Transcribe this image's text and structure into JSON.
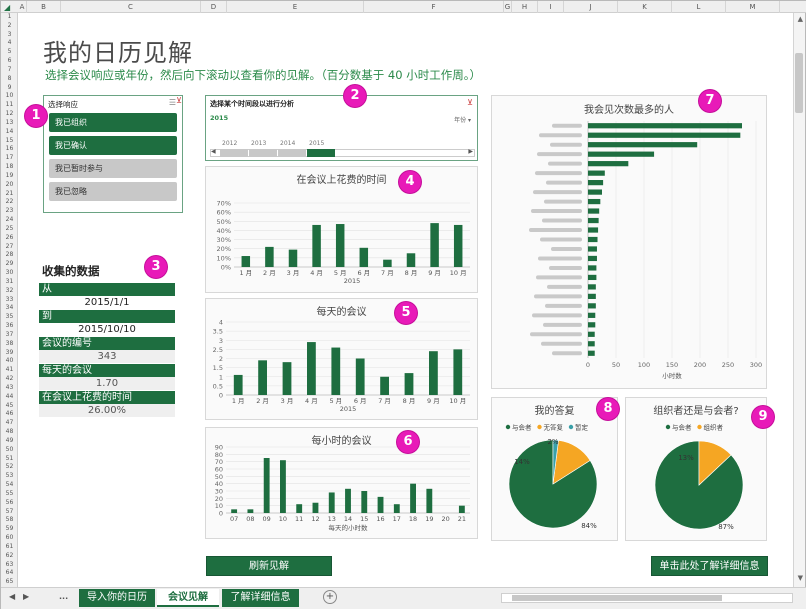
{
  "sheet": {
    "columns": [
      {
        "id": "A",
        "w": 9
      },
      {
        "id": "B",
        "w": 34
      },
      {
        "id": "C",
        "w": 140
      },
      {
        "id": "D",
        "w": 26
      },
      {
        "id": "E",
        "w": 137
      },
      {
        "id": "F",
        "w": 140
      },
      {
        "id": "G",
        "w": 8
      },
      {
        "id": "H",
        "w": 26
      },
      {
        "id": "I",
        "w": 26
      },
      {
        "id": "J",
        "w": 54
      },
      {
        "id": "K",
        "w": 54
      },
      {
        "id": "L",
        "w": 54
      },
      {
        "id": "M",
        "w": 54
      }
    ],
    "rows": [
      "1",
      "2",
      "3",
      "4",
      "5",
      "6",
      "7",
      "8",
      "9",
      "10",
      "11",
      "12",
      "13",
      "14",
      "15",
      "16",
      "17",
      "18",
      "19",
      "20",
      "21",
      "22",
      "23",
      "24",
      "25",
      "26",
      "27",
      "28",
      "29",
      "30",
      "31",
      "32",
      "33",
      "34",
      "35",
      "36",
      "37",
      "38",
      "39",
      "40",
      "41",
      "42",
      "43",
      "44",
      "45",
      "46",
      "47",
      "48",
      "49",
      "50",
      "51",
      "52",
      "53",
      "54",
      "55",
      "56",
      "57",
      "58",
      "59",
      "60",
      "61",
      "62",
      "63",
      "64",
      "65"
    ]
  },
  "header": {
    "title": "我的日历见解",
    "subtitle": "选择会议响应或年份，然后向下滚动以查看你的见解。（百分数基于 40 小时工作周。）"
  },
  "markers": [
    "1",
    "2",
    "3",
    "4",
    "5",
    "6",
    "7",
    "8",
    "9"
  ],
  "slicer": {
    "title": "选择响应",
    "items": [
      {
        "label": "我已组织",
        "selected": true
      },
      {
        "label": "我已确认",
        "selected": true
      },
      {
        "label": "我已暂时参与",
        "selected": false
      },
      {
        "label": "我已忽略",
        "selected": false
      }
    ]
  },
  "timeline": {
    "title": "选择某个时间段以进行分析",
    "selected_year": "2015",
    "unit": "年份",
    "years": [
      "2012",
      "2013",
      "2014",
      "2015"
    ]
  },
  "collected": {
    "title": "收集的数据",
    "fields": [
      {
        "label": "从",
        "value": "2015/1/1",
        "gray": false
      },
      {
        "label": "到",
        "value": "2015/10/10",
        "gray": false
      },
      {
        "label": "会议的编号",
        "value": "343",
        "gray": true
      },
      {
        "label": "每天的会议",
        "value": "1.70",
        "gray": true
      },
      {
        "label": "在会议上花费的时间",
        "value": "26.00%",
        "gray": true
      }
    ]
  },
  "buttons": {
    "refresh": "刷新见解",
    "details": "单击此处了解详细信息"
  },
  "tabs": {
    "nav_more": "...",
    "items": [
      {
        "label": "导入你的日历",
        "active": false
      },
      {
        "label": "会议见解",
        "active": true
      },
      {
        "label": "了解详细信息",
        "active": false
      }
    ],
    "add": "+"
  },
  "colors": {
    "green": "#1e6e40",
    "orange": "#f5a623",
    "teal": "#3aa0a8",
    "marker": "#e81ab8"
  },
  "chart_data": [
    {
      "id": "time-in-meetings",
      "type": "bar",
      "title": "在会议上花费的时间",
      "categories": [
        "1 月",
        "2 月",
        "3 月",
        "4 月",
        "5 月",
        "6 月",
        "7 月",
        "8 月",
        "9 月",
        "10 月"
      ],
      "x_group_label": "2015",
      "values": [
        12,
        22,
        19,
        46,
        47,
        21,
        8,
        15,
        48,
        46
      ],
      "y_ticks": [
        "0%",
        "10%",
        "20%",
        "30%",
        "40%",
        "50%",
        "60%",
        "70%"
      ],
      "ylim": [
        0,
        70
      ]
    },
    {
      "id": "meetings-per-day",
      "type": "bar",
      "title": "每天的会议",
      "categories": [
        "1 月",
        "2 月",
        "3 月",
        "4 月",
        "5 月",
        "6 月",
        "7 月",
        "8 月",
        "9 月",
        "10 月"
      ],
      "x_group_label": "2015",
      "values": [
        1.1,
        1.9,
        1.8,
        2.9,
        2.6,
        2.0,
        1.0,
        1.2,
        2.4,
        2.5
      ],
      "y_ticks": [
        "0",
        "0.5",
        "1",
        "1.5",
        "2",
        "2.5",
        "3",
        "3.5",
        "4"
      ],
      "ylim": [
        0,
        4
      ]
    },
    {
      "id": "meetings-per-hour",
      "type": "bar",
      "title": "每小时的会议",
      "categories": [
        "07",
        "08",
        "09",
        "10",
        "11",
        "12",
        "13",
        "14",
        "15",
        "16",
        "17",
        "18",
        "19",
        "20",
        "21"
      ],
      "xlabel": "每天的小时数",
      "values": [
        5,
        5,
        75,
        72,
        12,
        14,
        28,
        33,
        30,
        22,
        12,
        40,
        33,
        0,
        10
      ],
      "y_ticks": [
        "0",
        "10",
        "20",
        "30",
        "40",
        "50",
        "60",
        "70",
        "80",
        "90"
      ],
      "ylim": [
        0,
        90
      ]
    },
    {
      "id": "people-seen-most",
      "type": "bar",
      "orientation": "horizontal",
      "title": "我会见次数最多的人",
      "xlabel": "小时数",
      "values": [
        275,
        272,
        195,
        118,
        72,
        30,
        27,
        25,
        22,
        20,
        19,
        18,
        17,
        16,
        16,
        15,
        15,
        14,
        14,
        14,
        13,
        13,
        12,
        12,
        12
      ],
      "x_ticks": [
        "0",
        "50",
        "100",
        "150",
        "200",
        "250",
        "300"
      ],
      "xlim": [
        0,
        300
      ]
    },
    {
      "id": "my-responses",
      "type": "pie",
      "title": "我的答复",
      "legend": [
        "与会者",
        "无答复",
        "暂定"
      ],
      "values": [
        84,
        14,
        2
      ],
      "data_labels": [
        "84%",
        "14%",
        "2%"
      ]
    },
    {
      "id": "organizer-or-attendee",
      "type": "pie",
      "title": "组织者还是与会者?",
      "legend": [
        "与会者",
        "组织者"
      ],
      "values": [
        87,
        13
      ],
      "data_labels": [
        "87%",
        "13%"
      ]
    }
  ]
}
